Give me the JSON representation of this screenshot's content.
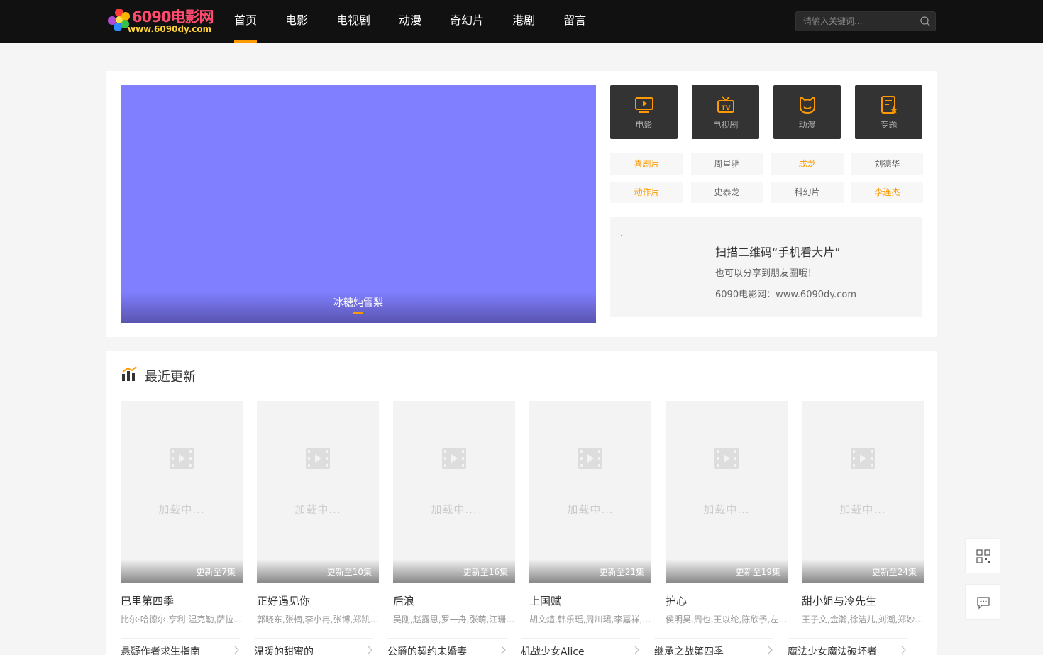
{
  "logo": {
    "title": "6090电影网",
    "url": "www.6090dy.com"
  },
  "nav": [
    {
      "label": "首页",
      "active": true
    },
    {
      "label": "电影"
    },
    {
      "label": "电视剧"
    },
    {
      "label": "动漫"
    },
    {
      "label": "奇幻片"
    },
    {
      "label": "港剧"
    },
    {
      "label": "留言"
    }
  ],
  "search": {
    "placeholder": "请输入关键词..."
  },
  "banner": {
    "caption": "冰糖炖雪梨",
    "color": "#7f7fff"
  },
  "categories": [
    {
      "label": "电影",
      "icon": "movie-icon"
    },
    {
      "label": "电视剧",
      "icon": "tv-icon"
    },
    {
      "label": "动漫",
      "icon": "anime-icon"
    },
    {
      "label": "专题",
      "icon": "topic-icon"
    }
  ],
  "tags": [
    {
      "label": "喜剧片",
      "hot": true
    },
    {
      "label": "周星驰"
    },
    {
      "label": "成龙",
      "hot": true
    },
    {
      "label": "刘德华"
    },
    {
      "label": "动作片",
      "hot": true
    },
    {
      "label": "史泰龙"
    },
    {
      "label": "科幻片"
    },
    {
      "label": "李连杰",
      "hot": true
    }
  ],
  "qr": {
    "line1": "扫描二维码“手机看大片”",
    "line2": "也可以分享到朋友圈哦！",
    "line3": "6090电影网：www.6090dy.com"
  },
  "recent": {
    "title": "最近更新",
    "loading": "加载中...",
    "cards": [
      {
        "name": "巴里第四季",
        "ep": "更新至7集",
        "actors": "比尔·哈德尔,亨利·温克勒,萨拉·戈德伯格"
      },
      {
        "name": "正好遇见你",
        "ep": "更新至10集",
        "actors": "郭晓东,张楠,李小冉,张博,郑凯,谭松韵"
      },
      {
        "name": "后浪",
        "ep": "更新至16集",
        "actors": "吴刚,赵露思,罗一舟,张萌,江珊,王劲松"
      },
      {
        "name": "上国赋",
        "ep": "更新至21集",
        "actors": "胡文煊,韩乐瑶,周川珺,李嘉祥,张韶涵"
      },
      {
        "name": "护心",
        "ep": "更新至19集",
        "actors": "侯明昊,周也,王以纶,陈欣予,左叶,王瑞"
      },
      {
        "name": "甜小姐与冷先生",
        "ep": "更新至24集",
        "actors": "王子文,金瀚,徐洁儿,刘潮,郑妙,王若珊"
      }
    ],
    "more": [
      "悬疑作者求生指南",
      "温暖的甜蜜的",
      "公爵的契约未婚妻",
      "机战少女Alice",
      "继承之战第四季",
      "魔法少女魔法破坏者"
    ]
  },
  "colors": {
    "accent": "#ff9900",
    "header_bg": "#111111"
  }
}
